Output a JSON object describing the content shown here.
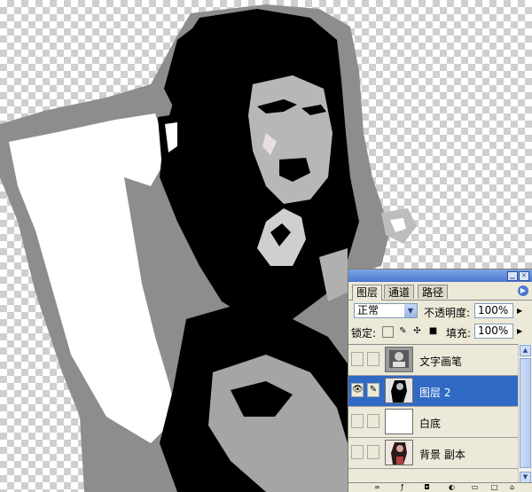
{
  "canvas": {
    "description_icon": "photo-canvas"
  },
  "layers_panel": {
    "tabs": [
      {
        "label": "图层",
        "active": true
      },
      {
        "label": "通道",
        "active": false
      },
      {
        "label": "路径",
        "active": false
      }
    ],
    "blend_mode": "正常",
    "opacity_label": "不透明度:",
    "opacity_value": "100%",
    "lock_label": "锁定:",
    "fill_label": "填充:",
    "fill_value": "100%",
    "layers": [
      {
        "name": "文字画笔",
        "visible": false,
        "selected": false,
        "thumb": "texture"
      },
      {
        "name": "图层 2",
        "visible": true,
        "selected": true,
        "thumb": "portrait-bw"
      },
      {
        "name": "白底",
        "visible": false,
        "selected": false,
        "thumb": "white"
      },
      {
        "name": "背景 副本",
        "visible": false,
        "selected": false,
        "thumb": "portrait-color"
      }
    ],
    "colors": {
      "selection": "#316ac5",
      "panel_bg": "#ece9d8",
      "title_bar": "#4a78d0"
    }
  }
}
